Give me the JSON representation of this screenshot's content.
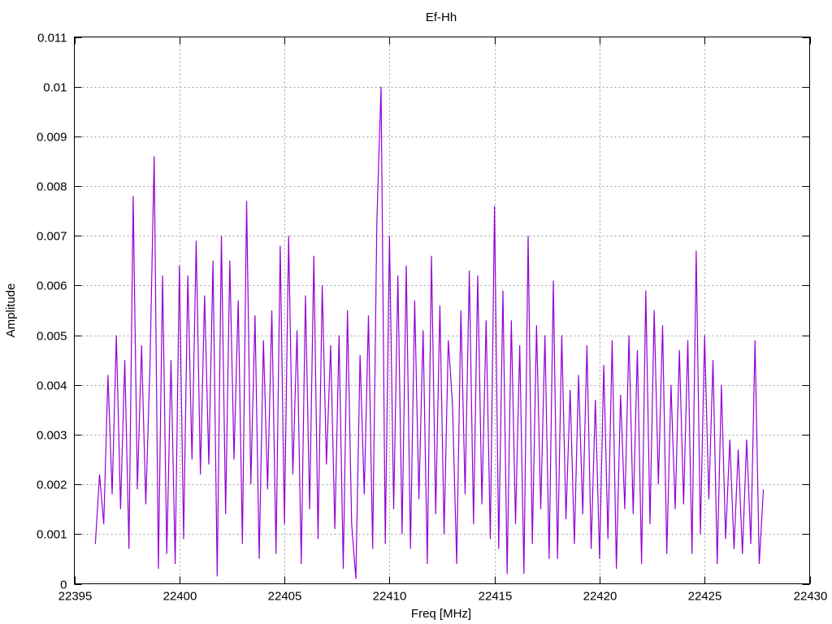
{
  "chart_data": {
    "type": "line",
    "title": "Ef-Hh",
    "xlabel": "Freq [MHz]",
    "ylabel": "Amplitude",
    "xlim": [
      22395,
      22430
    ],
    "ylim": [
      0,
      0.011
    ],
    "xticks": [
      22395,
      22400,
      22405,
      22410,
      22415,
      22420,
      22425,
      22430
    ],
    "xtick_labels": [
      "22395",
      "22400",
      "22405",
      "22410",
      "22415",
      "22420",
      "22425",
      "22430"
    ],
    "yticks": [
      0,
      0.001,
      0.002,
      0.003,
      0.004,
      0.005,
      0.006,
      0.007,
      0.008,
      0.009,
      0.01,
      0.011
    ],
    "ytick_labels": [
      "0",
      "0.001",
      "0.002",
      "0.003",
      "0.004",
      "0.005",
      "0.006",
      "0.007",
      "0.008",
      "0.009",
      "0.01",
      "0.011"
    ],
    "grid": true,
    "legend": "none",
    "series": [
      {
        "name": "Ef-Hh",
        "color": "#9400d3",
        "x_start": 22396.0,
        "x_step": 0.2,
        "values": [
          0.0008,
          0.0022,
          0.0012,
          0.0042,
          0.0018,
          0.005,
          0.0015,
          0.0045,
          0.0007,
          0.0078,
          0.0019,
          0.0048,
          0.0016,
          0.0044,
          0.0086,
          0.0003,
          0.0062,
          0.0006,
          0.0045,
          0.0004,
          0.0064,
          0.0009,
          0.0062,
          0.0025,
          0.0069,
          0.0022,
          0.0058,
          0.0024,
          0.0065,
          0.00015,
          0.007,
          0.0014,
          0.0065,
          0.0025,
          0.0057,
          0.0008,
          0.0077,
          0.002,
          0.0054,
          0.0005,
          0.0049,
          0.0019,
          0.0055,
          0.0006,
          0.0068,
          0.0012,
          0.007,
          0.0022,
          0.0051,
          0.0004,
          0.0058,
          0.0015,
          0.0066,
          0.0009,
          0.006,
          0.0024,
          0.0048,
          0.0011,
          0.005,
          0.0003,
          0.0055,
          0.0012,
          0.0001,
          0.0046,
          0.0018,
          0.0054,
          0.0007,
          0.0073,
          0.01,
          0.0008,
          0.007,
          0.0015,
          0.0062,
          0.001,
          0.0064,
          0.0007,
          0.0057,
          0.0017,
          0.0051,
          0.0004,
          0.0066,
          0.0014,
          0.0056,
          0.001,
          0.0049,
          0.0036,
          0.0004,
          0.0055,
          0.0018,
          0.0063,
          0.0012,
          0.0062,
          0.0016,
          0.0053,
          0.0009,
          0.0076,
          0.0007,
          0.0059,
          0.0002,
          0.0053,
          0.0012,
          0.0048,
          0.0002,
          0.007,
          0.0008,
          0.0052,
          0.0015,
          0.005,
          0.0005,
          0.0061,
          0.0005,
          0.005,
          0.0013,
          0.0039,
          0.0008,
          0.0042,
          0.0014,
          0.0048,
          0.0007,
          0.0037,
          0.0005,
          0.0044,
          0.0009,
          0.0049,
          0.0003,
          0.0038,
          0.0015,
          0.005,
          0.0014,
          0.0047,
          0.0004,
          0.0059,
          0.0012,
          0.0055,
          0.002,
          0.0052,
          0.0006,
          0.004,
          0.0015,
          0.0047,
          0.0016,
          0.0049,
          0.0006,
          0.0067,
          0.001,
          0.005,
          0.0017,
          0.0045,
          0.0004,
          0.004,
          0.0009,
          0.0029,
          0.0007,
          0.0027,
          0.0006,
          0.0029,
          0.0008,
          0.0049,
          0.0004,
          0.0019
        ]
      }
    ]
  }
}
